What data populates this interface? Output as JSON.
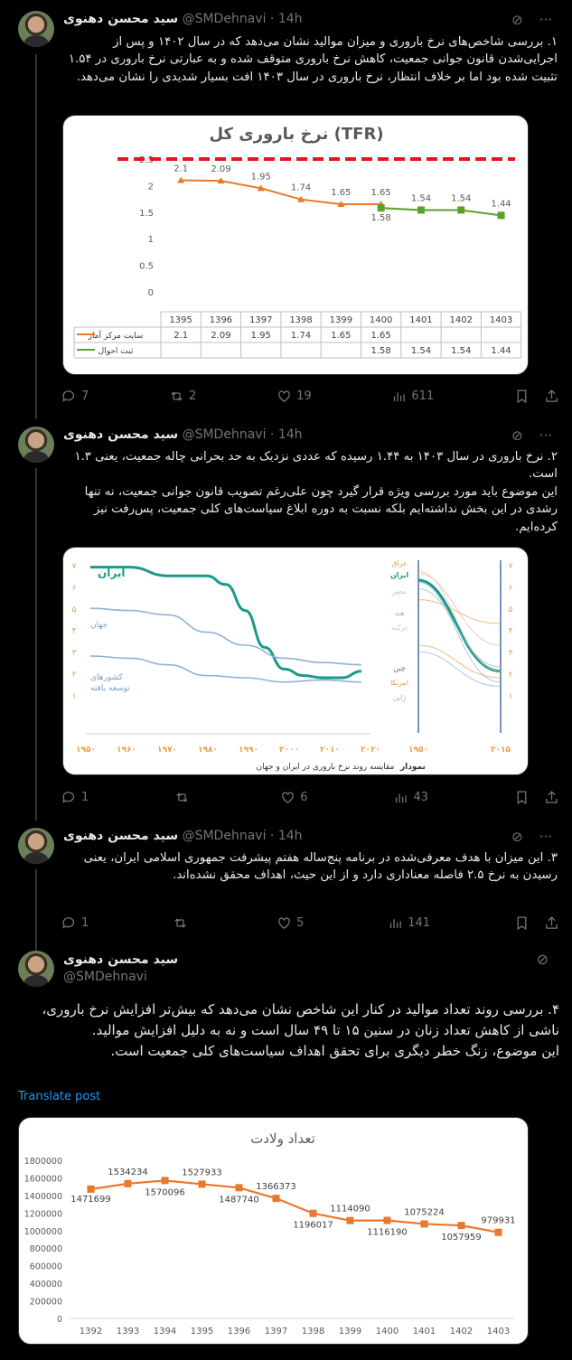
{
  "tweets": [
    {
      "name": "سید محسن دهنوی",
      "handle": "@SMDehnavi",
      "time": "14h",
      "text": "۱. بررسی شاخص‌های نرخ باروری و میزان موالید نشان می‌دهد که در سال ۱۴۰۲ و پس از اجرایی‌شدن قانون جوانی جمعیت، کاهش نرخ باروری متوقف شده و به عبارتی نرخ باروری در ۱.۵۴ تثبیت شده بود اما بر خلاف انتظار، نرخ باروری در سال ۱۴۰۳ افت بسیار شدیدی را نشان می‌دهد.",
      "replies": "7",
      "reposts": "2",
      "likes": "19",
      "views": "611"
    },
    {
      "name": "سید محسن دهنوی",
      "handle": "@SMDehnavi",
      "time": "14h",
      "text": "۲. نرخ باروری در سال ۱۴۰۳ به ۱.۴۴ رسیده که عددی نزدیک به حد بحرانی چاله جمعیت، یعنی ۱.۳ است.\nاین موضوع باید مورد بررسی ویژه قرار گیرد چون علی‌رغم تصویب قانون جوانی جمعیت، نه تنها رشدی در این بخش نداشته‌ایم بلکه نسبت به دوره ابلاغ سیاست‌های کلی جمعیت، پس‌رفت نیز کرده‌ایم.",
      "replies": "1",
      "reposts": "",
      "likes": "6",
      "views": "43"
    },
    {
      "name": "سید محسن دهنوی",
      "handle": "@SMDehnavi",
      "time": "14h",
      "text": "۳. این میزان با هدف معرفی‌شده در برنامه پنج‌ساله هفتم پیشرفت جمهوری اسلامی ایران، یعنی رسیدن به نرخ ۲.۵ فاصله معناداری دارد و از این حیث، اهداف محقق نشده‌اند.",
      "replies": "1",
      "reposts": "",
      "likes": "5",
      "views": "141"
    },
    {
      "name": "سید محسن دهنوی",
      "handle": "@SMDehnavi",
      "text": "۴. بررسی روند تعداد موالید در کنار این شاخص نشان می‌دهد که بیش‌تر افزایش نرخ باروری، ناشی از کاهش تعداد زنان در سنین ۱۵ تا ۴۹ سال است و نه به دلیل افزایش موالید.\nاین موضوع، زنگ خطر دیگری برای تحقق اهداف سیاست‌های کلی جمعیت است.",
      "translate": "Translate post"
    }
  ],
  "chart_data": [
    {
      "type": "line",
      "title": "نرخ باروری کل (TFR)",
      "categories": [
        "1395",
        "1396",
        "1397",
        "1398",
        "1399",
        "1400",
        "1401",
        "1402",
        "1403"
      ],
      "series": [
        {
          "name": "سایت مرکز آمار",
          "values": [
            2.1,
            2.09,
            1.95,
            1.74,
            1.65,
            1.65,
            null,
            null,
            null
          ],
          "color": "#e9782a"
        },
        {
          "name": "ثبت احوال",
          "values": [
            null,
            null,
            null,
            null,
            null,
            1.58,
            1.54,
            1.54,
            1.44
          ],
          "color": "#5aa02c"
        }
      ],
      "reference_line": {
        "value": 2.5,
        "color": "#e8141c",
        "style": "dashed"
      },
      "ylim": [
        0,
        2.5
      ],
      "yticks": [
        "0",
        "0.5",
        "1",
        "1.5",
        "2",
        "2.5"
      ],
      "legend": "bottom table"
    },
    {
      "type": "line",
      "title": "مقایسه روند نرخ باروری در ایران و جهان",
      "label_prefix": "نمودار",
      "xticks": [
        "۱۹۵۰",
        "۱۹۶۰",
        "۱۹۷۰",
        "۱۹۸۰",
        "۱۹۹۰",
        "۲۰۰۰",
        "۲۰۱۰",
        "۲۰۲۰"
      ],
      "right_xticks": [
        "۱۹۵۰",
        "۲۰۱۵"
      ],
      "yticks": [
        "۷",
        "۶",
        "۵",
        "۴",
        "۳",
        "۲",
        "۱"
      ],
      "series_labels": {
        "iran": "ایران",
        "world": "جهان",
        "developed_line1": "کشورهای",
        "developed_line2": "توسعه یافته"
      },
      "right_labels": [
        "عراق",
        "ایران",
        "مصر",
        "هند",
        "ترکیه",
        "چین",
        "امریکا",
        "ژاپن"
      ],
      "series": [
        {
          "name": "ایران",
          "x": [
            1950,
            1960,
            1970,
            1980,
            1985,
            1990,
            1995,
            2000,
            2005,
            2010,
            2015,
            2020
          ],
          "values": [
            6.9,
            6.9,
            6.5,
            6.5,
            6.1,
            4.9,
            3.2,
            2.2,
            1.9,
            1.8,
            1.8,
            2.1
          ],
          "color": "#1a9a8a"
        },
        {
          "name": "جهان",
          "x": [
            1950,
            1960,
            1970,
            1980,
            1990,
            2000,
            2010,
            2020
          ],
          "values": [
            5.0,
            4.9,
            4.7,
            3.9,
            3.3,
            2.7,
            2.5,
            2.4
          ],
          "color": "#8fb2d6"
        },
        {
          "name": "کشورهای توسعه یافته",
          "x": [
            1950,
            1960,
            1970,
            1980,
            1990,
            2000,
            2010,
            2020
          ],
          "values": [
            2.8,
            2.7,
            2.4,
            1.9,
            1.8,
            1.6,
            1.7,
            1.6
          ],
          "color": "#8fb2d6"
        }
      ]
    },
    {
      "type": "line",
      "title": "تعداد ولادت",
      "categories": [
        "1392",
        "1393",
        "1394",
        "1395",
        "1396",
        "1397",
        "1398",
        "1399",
        "1400",
        "1401",
        "1402",
        "1403"
      ],
      "values": [
        1471699,
        1534234,
        1570096,
        1527933,
        1487740,
        1366373,
        1196017,
        1114090,
        1116190,
        1075224,
        1057959,
        979931
      ],
      "yticks": [
        "0",
        "200000",
        "400000",
        "600000",
        "800000",
        "1000000",
        "1200000",
        "1400000",
        "1600000",
        "1800000"
      ],
      "ylim": [
        0,
        1800000
      ],
      "color": "#e9782a"
    }
  ]
}
